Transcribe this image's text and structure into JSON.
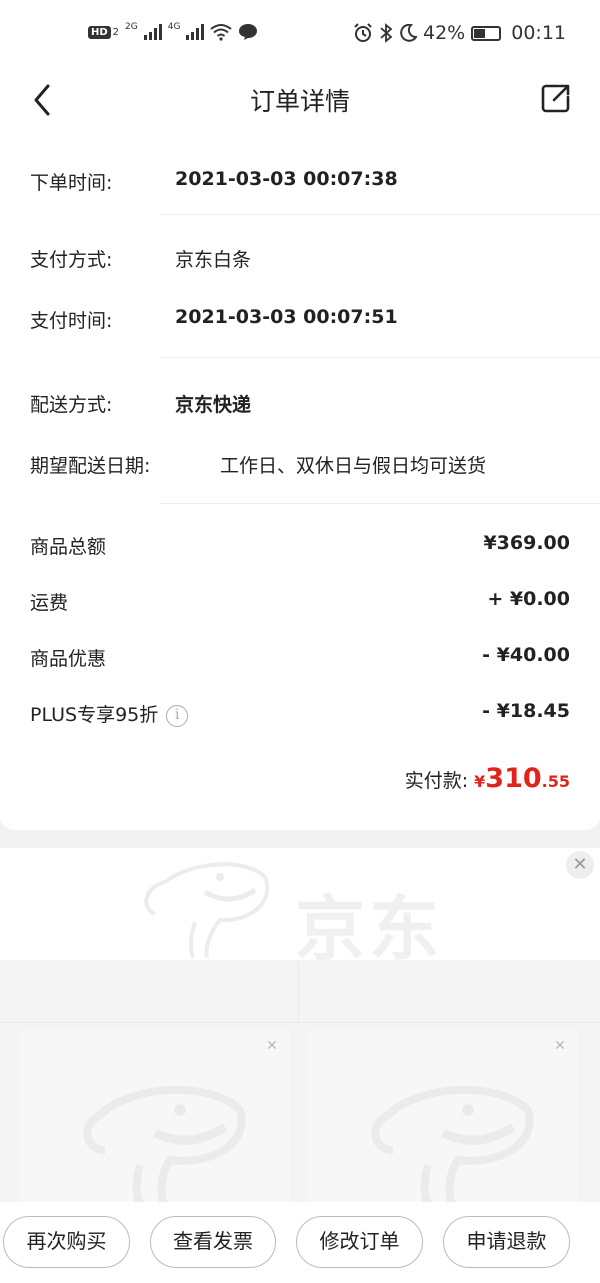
{
  "status_bar": {
    "hd": "HD",
    "sim": "2",
    "net1": "2G",
    "net2": "4G",
    "battery_level": 42,
    "battery": "42%",
    "time": "00:11"
  },
  "header": {
    "title": "订单详情"
  },
  "order_info": {
    "order_time_label": "下单时间:",
    "order_time": "2021-03-03 00:07:38",
    "pay_method_label": "支付方式:",
    "pay_method": "京东白条",
    "pay_time_label": "支付时间:",
    "pay_time": "2021-03-03 00:07:51",
    "delivery_method_label": "配送方式:",
    "delivery_method": "京东快递",
    "delivery_date_label": "期望配送日期:",
    "delivery_date": "工作日、双休日与假日均可送货"
  },
  "amounts": {
    "goods_total_label": "商品总额",
    "goods_total": "¥369.00",
    "shipping_label": "运费",
    "shipping": "+ ¥0.00",
    "discount_label": "商品优惠",
    "discount": "- ¥40.00",
    "plus_label": "PLUS专享95折",
    "plus": "- ¥18.45",
    "paid_label": "实付款:",
    "paid_currency": "¥",
    "paid_int": "310",
    "paid_dec": ".55"
  },
  "ad": {
    "brand_text": "京东"
  },
  "actions": {
    "rebuy": "再次购买",
    "invoice": "查看发票",
    "modify": "修改订单",
    "refund": "申请退款"
  },
  "colors": {
    "accent": "#e2231a"
  }
}
